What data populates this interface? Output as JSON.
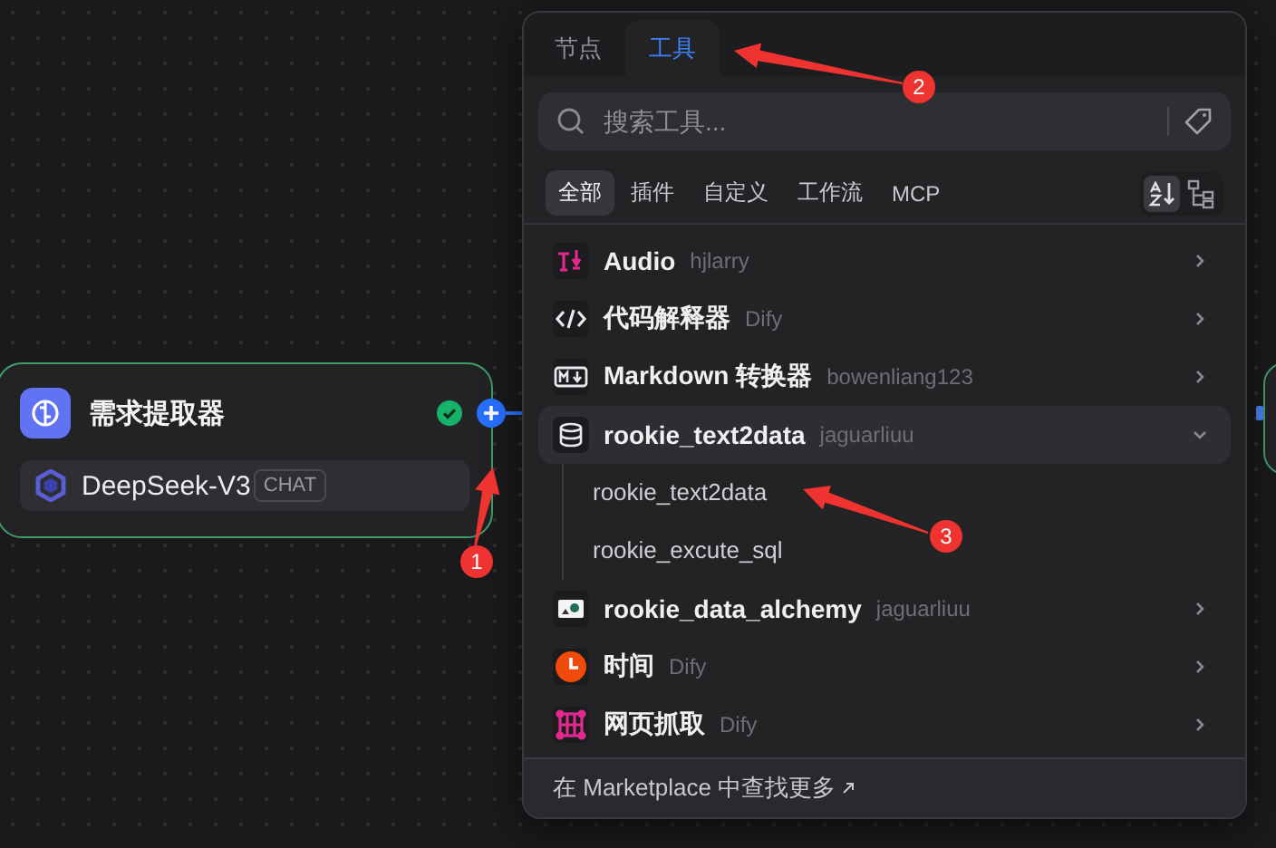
{
  "node": {
    "title": "需求提取器",
    "model": "DeepSeek-V3",
    "model_tag": "CHAT"
  },
  "popup": {
    "tabs": [
      {
        "label": "节点",
        "selected": false
      },
      {
        "label": "工具",
        "selected": true
      }
    ],
    "search": {
      "placeholder": "搜索工具..."
    },
    "filters": [
      {
        "label": "全部",
        "selected": true
      },
      {
        "label": "插件",
        "selected": false
      },
      {
        "label": "自定义",
        "selected": false
      },
      {
        "label": "工作流",
        "selected": false
      },
      {
        "label": "MCP",
        "selected": false
      }
    ],
    "tools": [
      {
        "name": "Audio",
        "author": "hjlarry",
        "expanded": false
      },
      {
        "name": "代码解释器",
        "author": "Dify",
        "expanded": false
      },
      {
        "name": "Markdown 转换器",
        "author": "bowenliang123",
        "expanded": false
      },
      {
        "name": "rookie_text2data",
        "author": "jaguarliuu",
        "expanded": true,
        "children": [
          "rookie_text2data",
          "rookie_excute_sql"
        ]
      },
      {
        "name": "rookie_data_alchemy",
        "author": "jaguarliuu",
        "expanded": false
      },
      {
        "name": "时间",
        "author": "Dify",
        "expanded": false
      },
      {
        "name": "网页抓取",
        "author": "Dify",
        "expanded": false
      }
    ],
    "footer": "在 Marketplace 中查找更多"
  },
  "annotations": [
    {
      "label": "1"
    },
    {
      "label": "2"
    },
    {
      "label": "3"
    }
  ]
}
